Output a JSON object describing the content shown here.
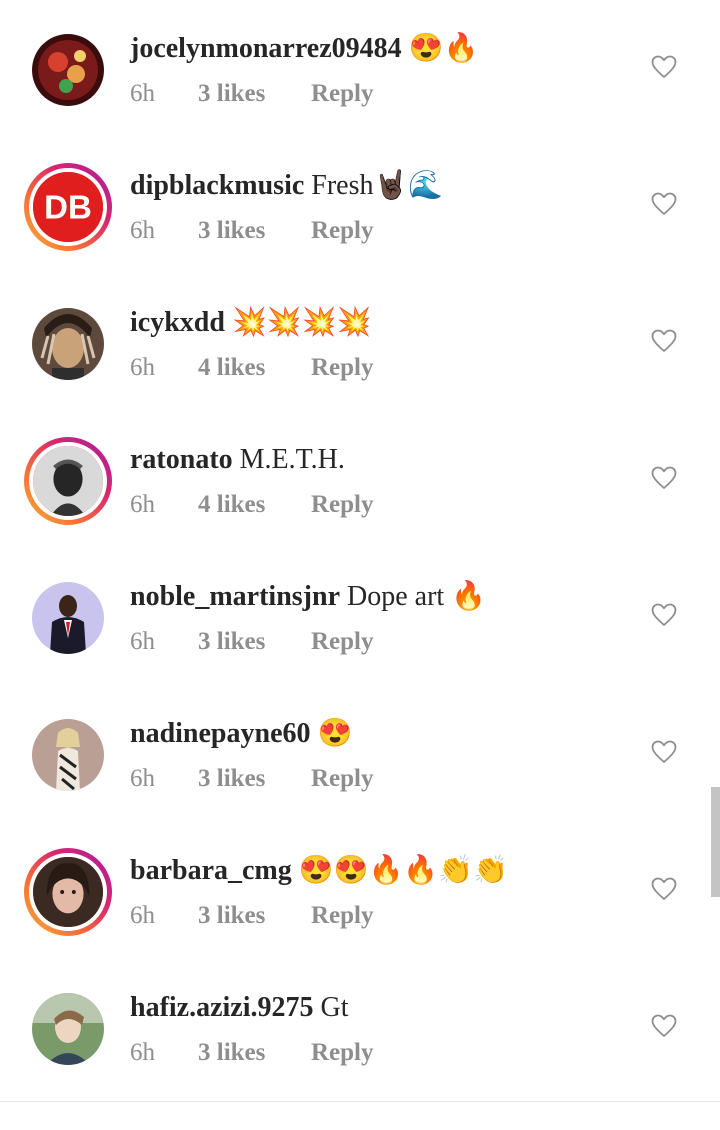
{
  "comments": [
    {
      "username": "jocelynmonarrez09484",
      "text": "😍🔥",
      "time": "6h",
      "likes": "3 likes",
      "reply": "Reply",
      "avatar_colors": [
        "#5a1010",
        "#c0392b"
      ]
    },
    {
      "username": "dipblackmusic",
      "text": "Fresh🤘🏿🌊",
      "time": "6h",
      "likes": "3 likes",
      "reply": "Reply",
      "avatar_colors": [
        "#e01e1e",
        "#ffffff"
      ]
    },
    {
      "username": "icykxdd",
      "text": "💥💥💥💥",
      "time": "6h",
      "likes": "4 likes",
      "reply": "Reply",
      "avatar_colors": [
        "#3a2a22",
        "#c9a27a"
      ]
    },
    {
      "username": "ratonato",
      "text": "M.E.T.H.",
      "time": "6h",
      "likes": "4 likes",
      "reply": "Reply",
      "avatar_colors": [
        "#d9d9d9",
        "#222222"
      ]
    },
    {
      "username": "noble_martinsjnr",
      "text": "Dope art 🔥",
      "time": "6h",
      "likes": "3 likes",
      "reply": "Reply",
      "avatar_colors": [
        "#c9c4ee",
        "#1a1a2a"
      ]
    },
    {
      "username": "nadinepayne60",
      "text": "😍",
      "time": "6h",
      "likes": "3 likes",
      "reply": "Reply",
      "avatar_colors": [
        "#b99f94",
        "#f0e7dd"
      ]
    },
    {
      "username": "barbara_cmg",
      "text": "😍😍🔥🔥👏👏",
      "time": "6h",
      "likes": "3 likes",
      "reply": "Reply",
      "avatar_colors": [
        "#3b2a22",
        "#e3b9a8"
      ]
    },
    {
      "username": "hafiz.azizi.9275",
      "text": "Gt",
      "time": "6h",
      "likes": "3 likes",
      "reply": "Reply",
      "avatar_colors": [
        "#7a9a6a",
        "#dde4d9"
      ]
    }
  ],
  "avatar_badges": {
    "dipblackmusic": "DB"
  },
  "icons": {
    "like": "heart-outline-icon"
  },
  "colors": {
    "text": "#262626",
    "meta": "#8e8e8e",
    "story_ring": [
      "#f9b233",
      "#d9266d",
      "#a31ea8"
    ]
  }
}
